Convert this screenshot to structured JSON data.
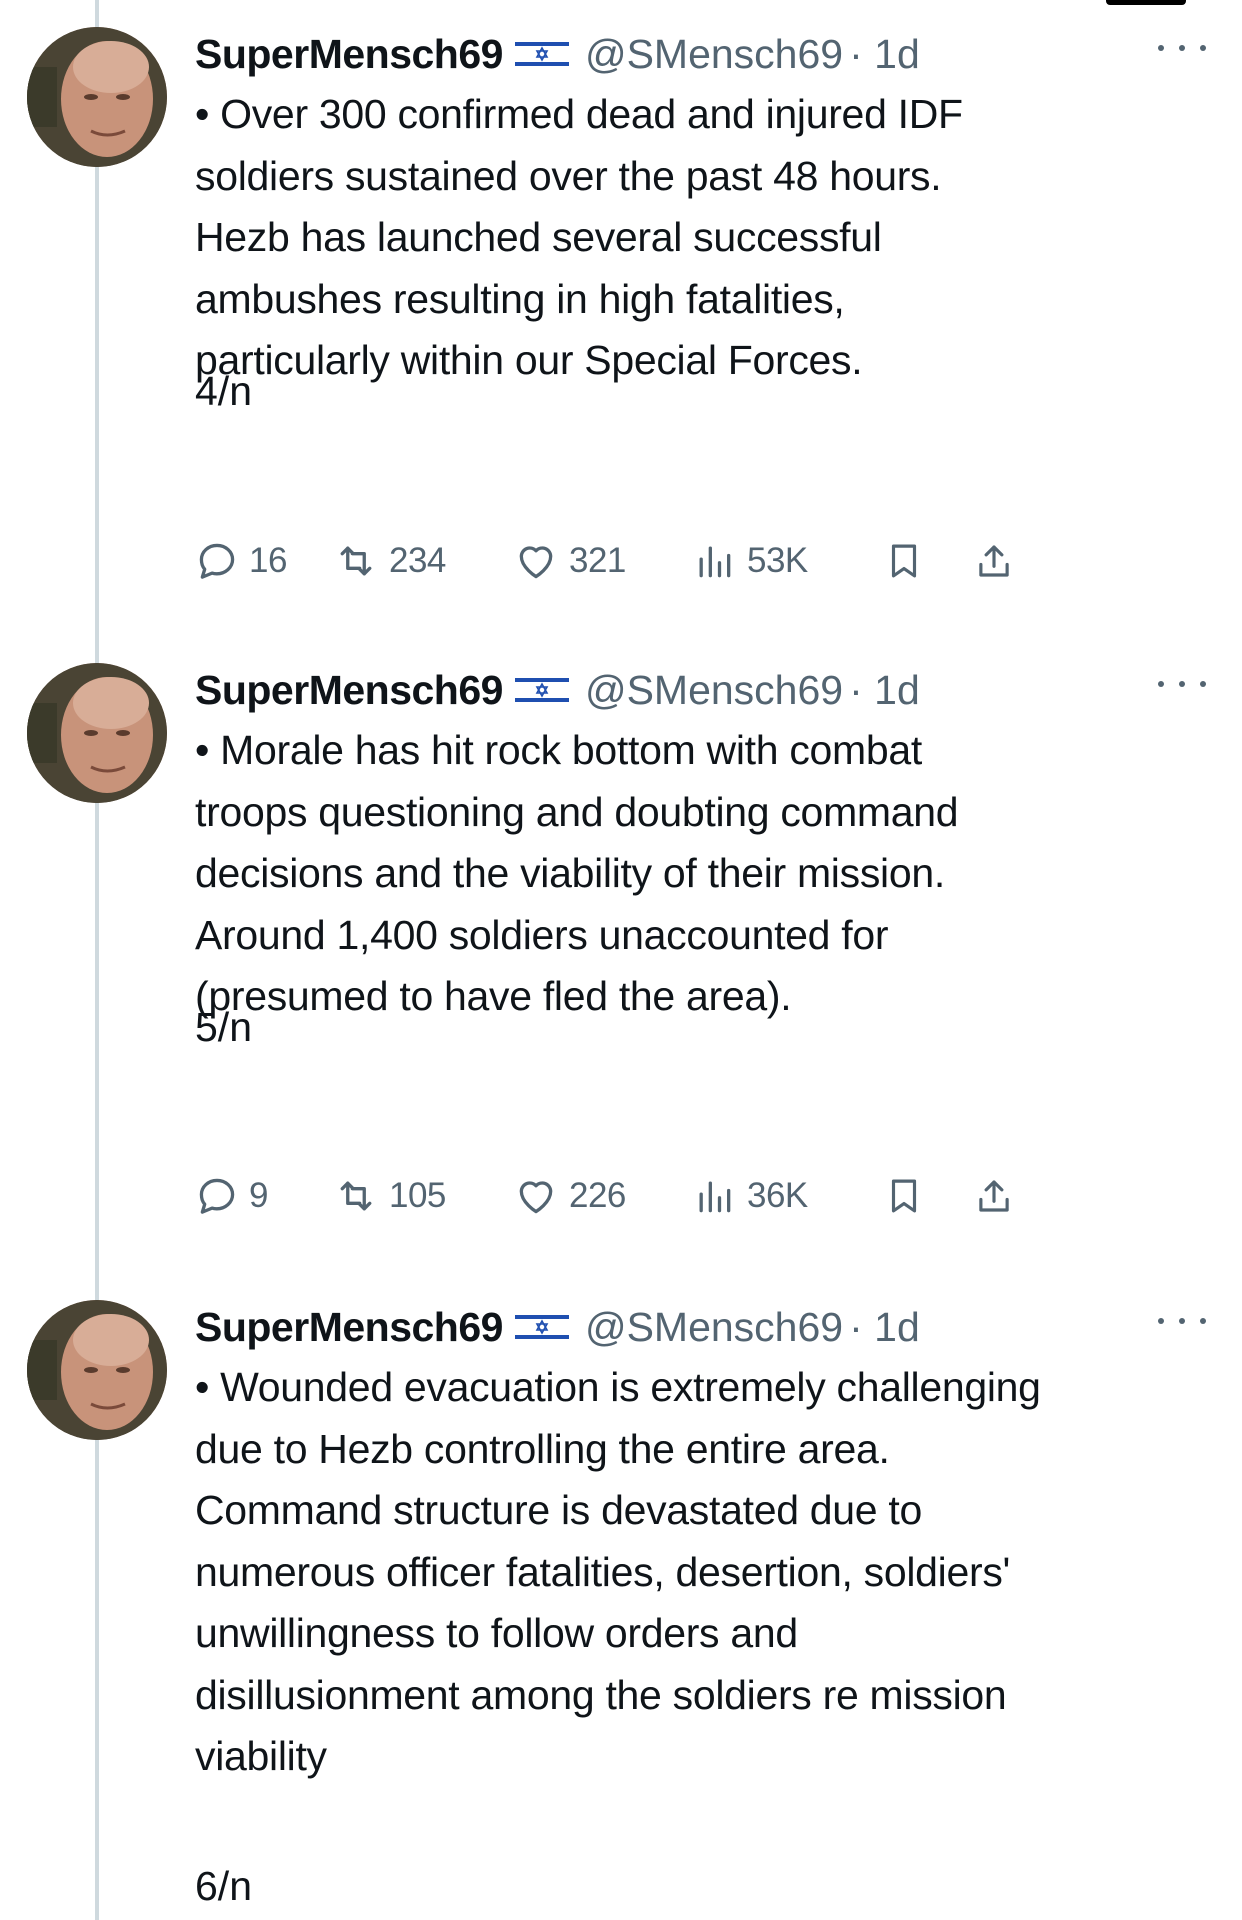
{
  "tweets": [
    {
      "display_name": "SuperMensch69",
      "handle": "@SMensch69",
      "time": "· 1d",
      "text": "• Over 300 confirmed dead and injured IDF\nsoldiers sustained over the past 48 hours.\nHezb has launched several successful\nambushes resulting in high fatalities,\nparticularly within our Special Forces.",
      "thread_marker": "4/n",
      "replies": "16",
      "reposts": "234",
      "likes": "321",
      "views": "53K"
    },
    {
      "display_name": "SuperMensch69",
      "handle": "@SMensch69",
      "time": "· 1d",
      "text": "• Morale has hit rock bottom with combat\ntroops questioning and doubting command\ndecisions and the viability of their mission.\nAround 1,400 soldiers unaccounted for\n(presumed to have fled the area).",
      "thread_marker": "5/n",
      "replies": "9",
      "reposts": "105",
      "likes": "226",
      "views": "36K"
    },
    {
      "display_name": "SuperMensch69",
      "handle": "@SMensch69",
      "time": "· 1d",
      "text": "• Wounded evacuation is extremely challenging\ndue to Hezb controlling the entire area.\nCommand structure is devastated due to\nnumerous officer fatalities, desertion, soldiers'\nunwillingness to follow orders and\ndisillusionment among the soldiers re mission\nviability",
      "thread_marker": "6/n"
    }
  ],
  "icons": {
    "flag": "israel-flag-icon",
    "more": "more-options-icon",
    "reply": "reply-icon",
    "repost": "repost-icon",
    "like": "heart-icon",
    "views": "views-icon",
    "bookmark": "bookmark-icon",
    "share": "share-icon"
  },
  "colors": {
    "text": "#0f1419",
    "secondary": "#536471",
    "thread_line": "#cfd9de",
    "flag_blue": "#1f4fb0"
  }
}
